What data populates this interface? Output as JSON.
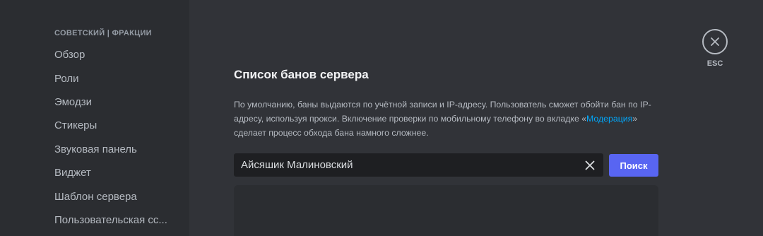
{
  "sidebar": {
    "header": "СОВЕТСКИЙ | ФРАКЦИИ",
    "items": [
      {
        "label": "Обзор"
      },
      {
        "label": "Роли"
      },
      {
        "label": "Эмодзи"
      },
      {
        "label": "Стикеры"
      },
      {
        "label": "Звуковая панель"
      },
      {
        "label": "Виджет"
      },
      {
        "label": "Шаблон сервера"
      },
      {
        "label": "Пользовательская сс..."
      }
    ]
  },
  "close": {
    "icon": "close-icon",
    "label": "ESC"
  },
  "main": {
    "title": "Список банов сервера",
    "description_before": "По умолчанию, баны выдаются по учётной записи и IP-адресу. Пользователь сможет обойти бан по IP-адресу, используя прокси. Включение проверки по мобильному телефону во вкладке «",
    "description_link": "Модерация",
    "description_after": "» сделает процесс обхода бана намного сложнее.",
    "search": {
      "value": "Айсяшик Малиновский",
      "clear_icon": "clear-icon",
      "button_label": "Поиск"
    }
  },
  "colors": {
    "background": "#313338",
    "sidebar": "#2b2d31",
    "accent": "#5865f2",
    "link": "#00a8fc"
  }
}
